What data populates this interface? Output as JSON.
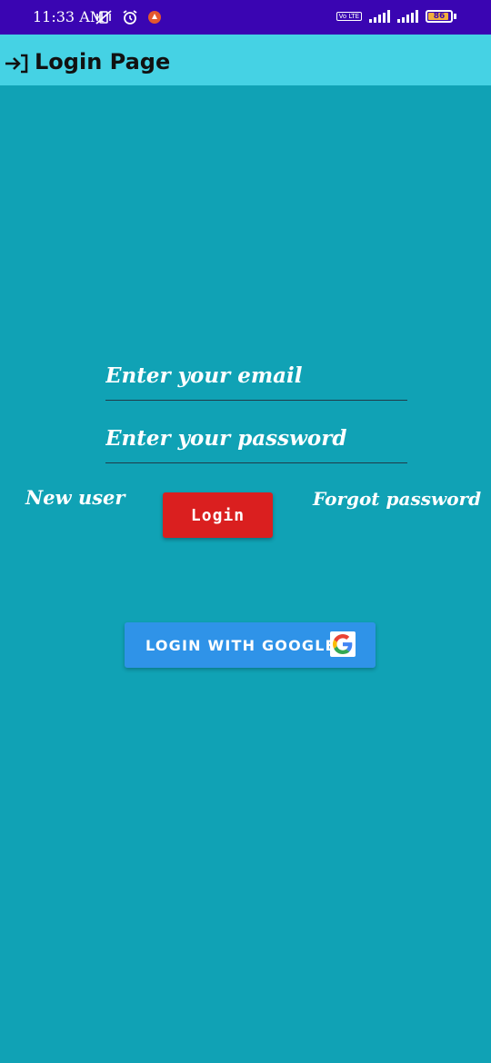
{
  "status_bar": {
    "time": "11:33 AM",
    "battery_level": "86",
    "network_badge": "Vo LTE",
    "icons": [
      "mute-vibrate-icon",
      "alarm-icon",
      "app-notification-icon",
      "volte-icon",
      "signal-icon",
      "signal-icon",
      "battery-icon"
    ]
  },
  "app_bar": {
    "title": "Login Page",
    "icon": "login-arrow-icon"
  },
  "form": {
    "email_placeholder": "Enter your email",
    "email_value": "",
    "password_placeholder": "Enter your password",
    "password_value": "",
    "new_user_label": "New user",
    "login_label": "Login",
    "forgot_label": "Forgot password"
  },
  "google": {
    "label": "LOGIN WITH GOOGLE",
    "icon": "google-g-icon"
  },
  "colors": {
    "background": "#10a2b5",
    "status_bar": "#3a05b2",
    "app_bar": "#45d2e4",
    "login_button": "#da1f1f",
    "google_button": "#2f93e8"
  }
}
